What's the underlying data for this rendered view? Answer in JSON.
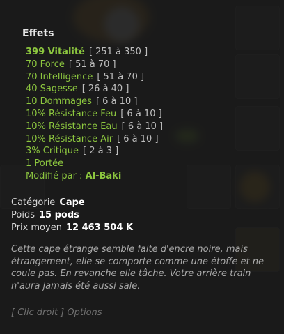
{
  "tooltip": {
    "effects_title": "Effets",
    "effects": [
      {
        "value": "399 Vitalité",
        "range": "[ 251 à 350 ]"
      },
      {
        "value": "70 Force",
        "range": "[ 51 à 70 ]"
      },
      {
        "value": "70 Intelligence",
        "range": "[ 51 à 70 ]"
      },
      {
        "value": "40 Sagesse",
        "range": "[ 26 à 40 ]"
      },
      {
        "value": "10 Dommages",
        "range": "[ 6 à 10 ]"
      },
      {
        "value": "10% Résistance Feu",
        "range": "[ 6 à 10 ]"
      },
      {
        "value": "10% Résistance Eau",
        "range": "[ 6 à 10 ]"
      },
      {
        "value": "10% Résistance Air",
        "range": "[ 6 à 10 ]"
      },
      {
        "value": "3% Critique",
        "range": "[ 2 à 3 ]"
      },
      {
        "value": "1 Portée",
        "range": ""
      }
    ],
    "modified_label": "Modifié par :",
    "modified_by": "Al-Baki",
    "category_label": "Catégorie",
    "category_value": "Cape",
    "weight_label": "Poids",
    "weight_value": "15 pods",
    "price_label": "Prix moyen",
    "price_value": "12 463 504 K",
    "description": "Cette cape étrange semble faite d'encre noire, mais étrangement, elle se comporte comme une étoffe et ne coule pas. En revanche elle tâche. Votre arrière train n'aura jamais été aussi sale.",
    "hint": "[ Clic droit ] Options"
  },
  "colors": {
    "bonus_green": "#8cc63f",
    "range_grey": "#bfbfbf",
    "description_grey": "#a9a9a9"
  }
}
